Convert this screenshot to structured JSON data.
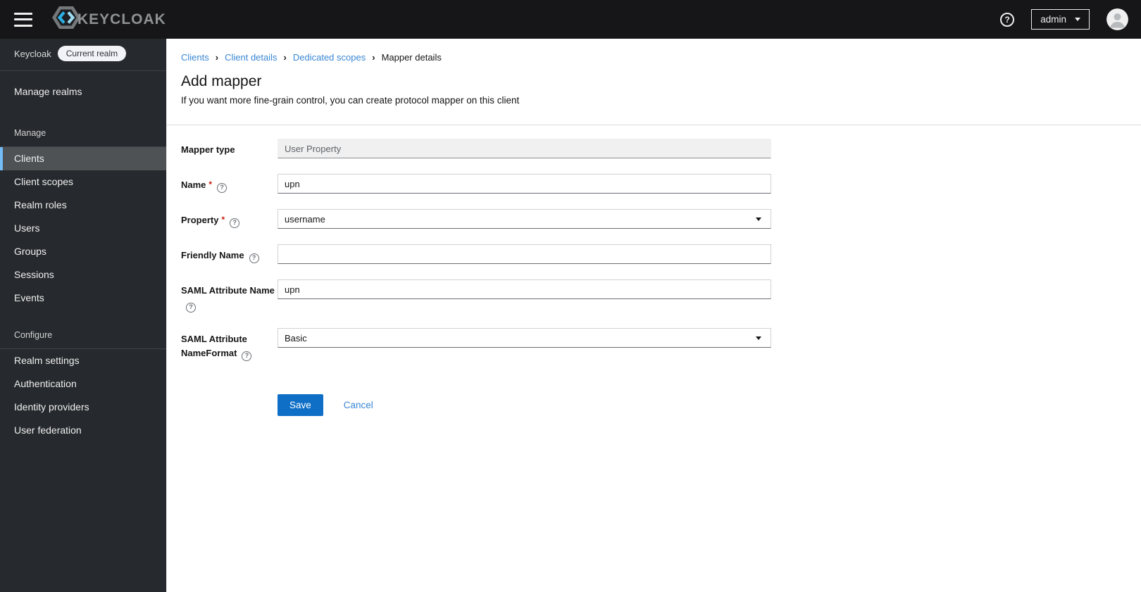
{
  "topbar": {
    "brand": "KEYCLOAK",
    "user_menu_label": "admin"
  },
  "icons": {
    "help": "?",
    "breadcrumb_separator": "›"
  },
  "sidebar": {
    "realm_name": "Keycloak",
    "realm_badge": "Current realm",
    "manage_realms_label": "Manage realms",
    "sections": [
      {
        "label": "Manage",
        "items": [
          {
            "label": "Clients",
            "selected": true
          },
          {
            "label": "Client scopes",
            "selected": false
          },
          {
            "label": "Realm roles",
            "selected": false
          },
          {
            "label": "Users",
            "selected": false
          },
          {
            "label": "Groups",
            "selected": false
          },
          {
            "label": "Sessions",
            "selected": false
          },
          {
            "label": "Events",
            "selected": false
          }
        ]
      },
      {
        "label": "Configure",
        "items": [
          {
            "label": "Realm settings",
            "selected": false
          },
          {
            "label": "Authentication",
            "selected": false
          },
          {
            "label": "Identity providers",
            "selected": false
          },
          {
            "label": "User federation",
            "selected": false
          }
        ]
      }
    ]
  },
  "breadcrumb": [
    "Clients",
    "Client details",
    "Dedicated scopes",
    "Mapper details"
  ],
  "page": {
    "title": "Add mapper",
    "subtitle": "If you want more fine-grain control, you can create protocol mapper on this client"
  },
  "form": {
    "required_marker": "*",
    "fields": [
      {
        "label": "Mapper type",
        "value": "User Property",
        "control": "readonly",
        "required": false,
        "help": false
      },
      {
        "label": "Name",
        "value": "upn",
        "control": "text",
        "required": true,
        "help": true
      },
      {
        "label": "Property",
        "value": "username",
        "control": "select",
        "required": true,
        "help": true
      },
      {
        "label": "Friendly Name",
        "value": "",
        "control": "text",
        "required": false,
        "help": true
      },
      {
        "label": "SAML Attribute Name",
        "value": "upn",
        "control": "text",
        "required": false,
        "help": true
      },
      {
        "label": "SAML Attribute NameFormat",
        "value": "Basic",
        "control": "select",
        "required": false,
        "help": true
      }
    ],
    "save_label": "Save",
    "cancel_label": "Cancel"
  },
  "colors": {
    "topbar_bg": "#161618",
    "sidebar_bg": "#26292d",
    "sidebar_selected_bg": "#4f5255",
    "sidebar_selected_border": "#73bcf7",
    "link_blue": "#3a87d4",
    "primary_button_blue": "#0f6fc7",
    "required_red": "#c9190b",
    "readonly_bg": "#f0f0f0"
  }
}
